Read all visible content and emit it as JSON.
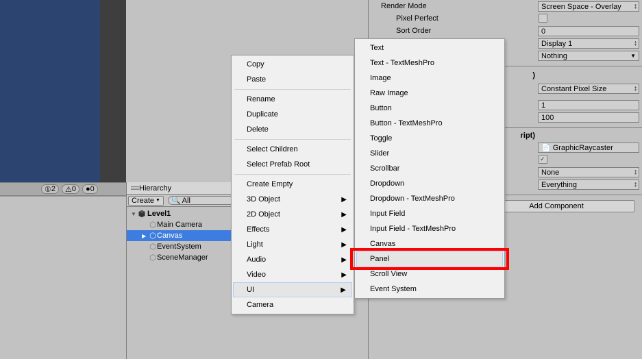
{
  "scene_toolbar": {
    "counter1": "2",
    "counter2": "0",
    "counter3": "0"
  },
  "hierarchy": {
    "tab_label": "Hierarchy",
    "create_label": "Create",
    "search_placeholder": "All",
    "scene_name": "Level1",
    "items": [
      {
        "label": "Main Camera"
      },
      {
        "label": "Canvas"
      },
      {
        "label": "EventSystem"
      },
      {
        "label": "SceneManager"
      }
    ]
  },
  "inspector": {
    "render_mode_label": "Render Mode",
    "render_mode_value": "Screen Space - Overlay",
    "pixel_perfect_label": "Pixel Perfect",
    "sort_order_label": "Sort Order",
    "sort_order_value": "0",
    "target_display_value": "Display 1",
    "additional_shader_value": "Nothing",
    "ui_scale_value": "Constant Pixel Size",
    "scale_factor_value": "1",
    "ref_px_value": "100",
    "script_suffix": "ript)",
    "script_field_value": "GraphicRaycaster",
    "ignore_value": "None",
    "blocking_value": "Everything",
    "add_component_label": "Add Component"
  },
  "context_menu_1": {
    "items": [
      {
        "label": "Copy",
        "type": "item"
      },
      {
        "label": "Paste",
        "type": "item"
      },
      {
        "type": "sep"
      },
      {
        "label": "Rename",
        "type": "item"
      },
      {
        "label": "Duplicate",
        "type": "item"
      },
      {
        "label": "Delete",
        "type": "item"
      },
      {
        "type": "sep"
      },
      {
        "label": "Select Children",
        "type": "item"
      },
      {
        "label": "Select Prefab Root",
        "type": "item",
        "disabled": true
      },
      {
        "type": "sep"
      },
      {
        "label": "Create Empty",
        "type": "item"
      },
      {
        "label": "3D Object",
        "type": "submenu"
      },
      {
        "label": "2D Object",
        "type": "submenu"
      },
      {
        "label": "Effects",
        "type": "submenu"
      },
      {
        "label": "Light",
        "type": "submenu"
      },
      {
        "label": "Audio",
        "type": "submenu"
      },
      {
        "label": "Video",
        "type": "submenu"
      },
      {
        "label": "UI",
        "type": "submenu",
        "hover": true
      },
      {
        "label": "Camera",
        "type": "item"
      }
    ]
  },
  "context_menu_2": {
    "items": [
      {
        "label": "Text"
      },
      {
        "label": "Text - TextMeshPro"
      },
      {
        "label": "Image"
      },
      {
        "label": "Raw Image"
      },
      {
        "label": "Button"
      },
      {
        "label": "Button - TextMeshPro"
      },
      {
        "label": "Toggle"
      },
      {
        "label": "Slider"
      },
      {
        "label": "Scrollbar"
      },
      {
        "label": "Dropdown"
      },
      {
        "label": "Dropdown - TextMeshPro"
      },
      {
        "label": "Input Field"
      },
      {
        "label": "Input Field - TextMeshPro"
      },
      {
        "label": "Canvas"
      },
      {
        "label": "Panel",
        "hover": true
      },
      {
        "label": "Scroll View"
      },
      {
        "label": "Event System"
      }
    ]
  }
}
